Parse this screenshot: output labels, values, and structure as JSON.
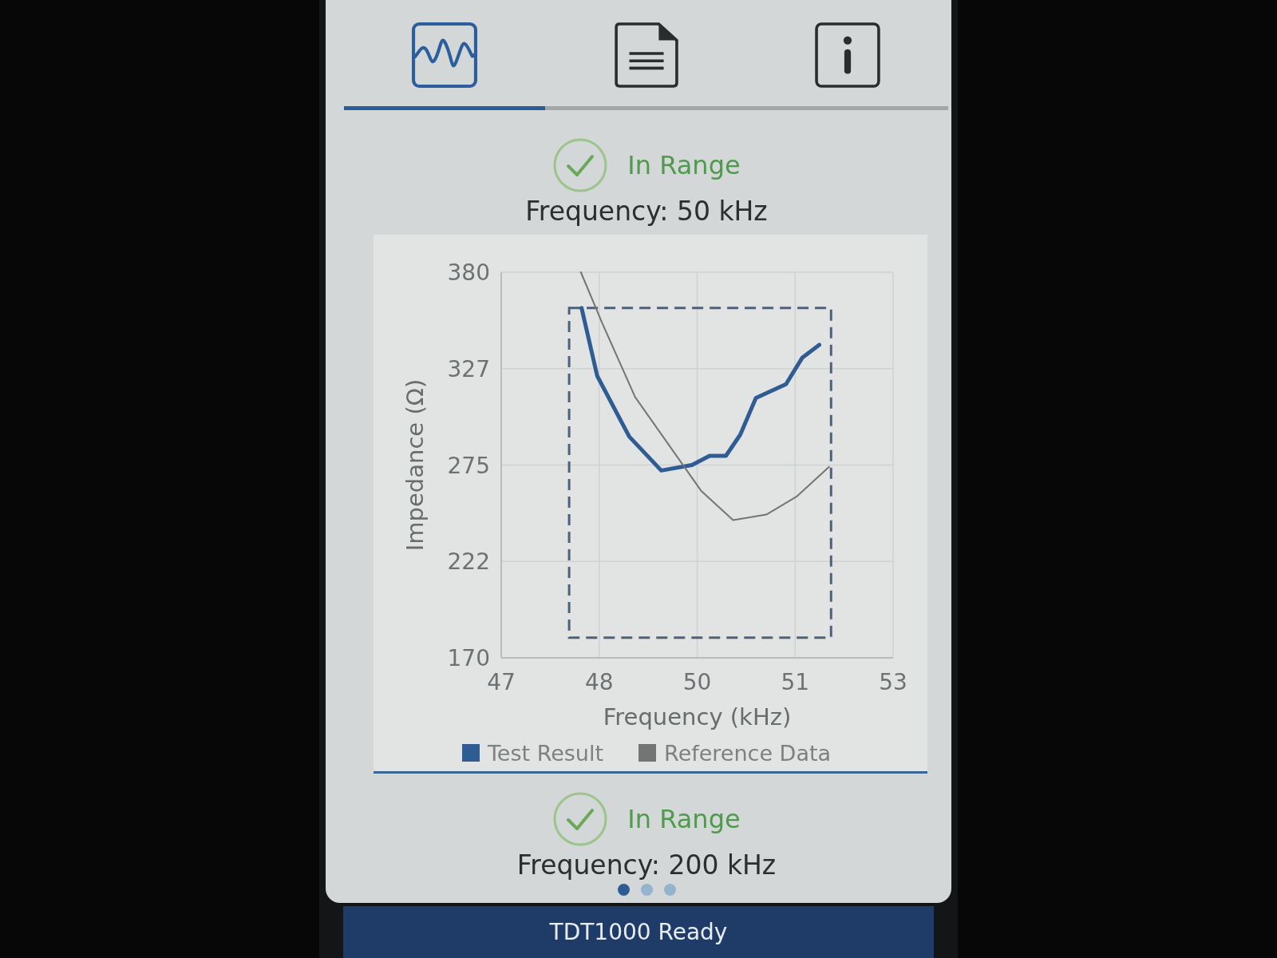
{
  "tabs": [
    {
      "kind": "graph",
      "selected": true
    },
    {
      "kind": "report",
      "selected": false
    },
    {
      "kind": "info",
      "selected": false
    }
  ],
  "results": [
    {
      "status": "In Range",
      "frequency": "Frequency: 50 kHz",
      "chart_data": {
        "type": "line",
        "xlabel": "Frequency (kHz)",
        "ylabel": "Impedance (Ω)",
        "xlim": [
          47,
          53
        ],
        "ylim": [
          170,
          380
        ],
        "grid": true,
        "xticks": [
          {
            "value": 47,
            "label": "47"
          },
          {
            "value": 48.5,
            "label": "48"
          },
          {
            "value": 50,
            "label": "50"
          },
          {
            "value": 51.5,
            "label": "51"
          },
          {
            "value": 53,
            "label": "53"
          }
        ],
        "yticks": [
          {
            "value": 170,
            "label": "170"
          },
          {
            "value": 222.5,
            "label": "222"
          },
          {
            "value": 275,
            "label": "275"
          },
          {
            "value": 327.5,
            "label": "327"
          },
          {
            "value": 380,
            "label": "380"
          }
        ],
        "series": [
          {
            "name": "Test Result",
            "color": "#2f5c92",
            "x": [
              48.23,
              48.47,
              48.96,
              49.45,
              49.92,
              50.19,
              50.44,
              50.66,
              50.9,
              51.36,
              51.61,
              51.87
            ],
            "values": [
              360.5,
              323.5,
              290.5,
              272,
              275,
              280,
              280,
              291.5,
              311.5,
              319,
              333.5,
              340.5
            ]
          },
          {
            "name": "Reference Data",
            "color": "#737474",
            "x": [
              48.22,
              48.55,
              49.05,
              50.06,
              50.55,
              51.06,
              51.53,
              52.02
            ],
            "values": [
              380,
              352,
              312,
              261,
              245,
              248,
              258,
              274
            ]
          }
        ]
      }
    },
    {
      "status": "In Range",
      "frequency": "Frequency: 200 kHz"
    }
  ],
  "pages": [
    {
      "selected": true
    },
    {
      "selected": false
    },
    {
      "selected": false
    }
  ],
  "status_bar": "TDT1000 Ready"
}
